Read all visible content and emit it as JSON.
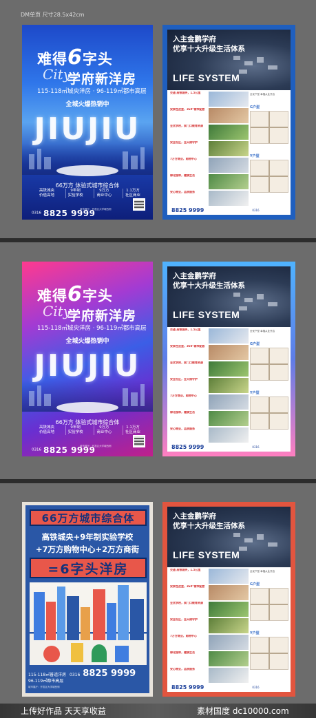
{
  "header": {
    "label": "DM单页 尺寸28.5x42cm"
  },
  "left_poster": {
    "title_prefix": "难得",
    "title_six": "6",
    "title_suffix": "字头",
    "script": "City",
    "subtitle": "学府新洋房",
    "area_1": "115-118㎡城央洋房",
    "area_2": "96-119㎡都市高层",
    "hot": "全城火爆热销中",
    "jiu": "JIUJIU",
    "complex": "66万方 体验式城市综合体",
    "features": [
      {
        "a": "高铁城央",
        "b": "价值高地"
      },
      {
        "a": "9年制",
        "b": "实验学校"
      },
      {
        "a": "9万方",
        "b": "商业中心"
      },
      {
        "a": "1.1万方",
        "b": "社区商业"
      }
    ],
    "area_code": "0316",
    "phone": "8825 9999",
    "address": "城市展厅：开发区大学城西侧"
  },
  "right_poster": {
    "head_1": "入主金鹏学府",
    "head_2": "优享十大升级生活体系",
    "life": "LIFE SYSTEM",
    "rows": [
      {
        "t": "交通 高铁城央，1.5公里"
      },
      {
        "t": "安家在这里，360°城市配套"
      },
      {
        "t": "全优学校，家门口教育资源"
      },
      {
        "t": "安全社区，全天候守护"
      },
      {
        "t": "7万方商业，购物中心"
      },
      {
        "t": "绿化园林，健康生活"
      },
      {
        "t": "安心物业，品质服务"
      }
    ],
    "plan_label": "全优户型 幸福从此开启",
    "plan_a": "G户型",
    "plan_b": "Y户型",
    "phone": "8825 9999",
    "area_code": "0316"
  },
  "third_poster": {
    "banner_1": "66万方城市综合体",
    "line_1": "高铁城央+9年制实验学校",
    "line_2": "+7万方购物中心+2万方商街",
    "banner_2": "=6字头洋房",
    "area": "115-118㎡普适洋房",
    "area_b": "96-119㎡都市高层",
    "area_code": "0316",
    "phone": "8825 9999",
    "address": "城市展厅：开发区大学城西侧"
  },
  "watermark": {
    "left": "上传好作品 天天享收益",
    "right": "素材国度 dc10000.com"
  }
}
